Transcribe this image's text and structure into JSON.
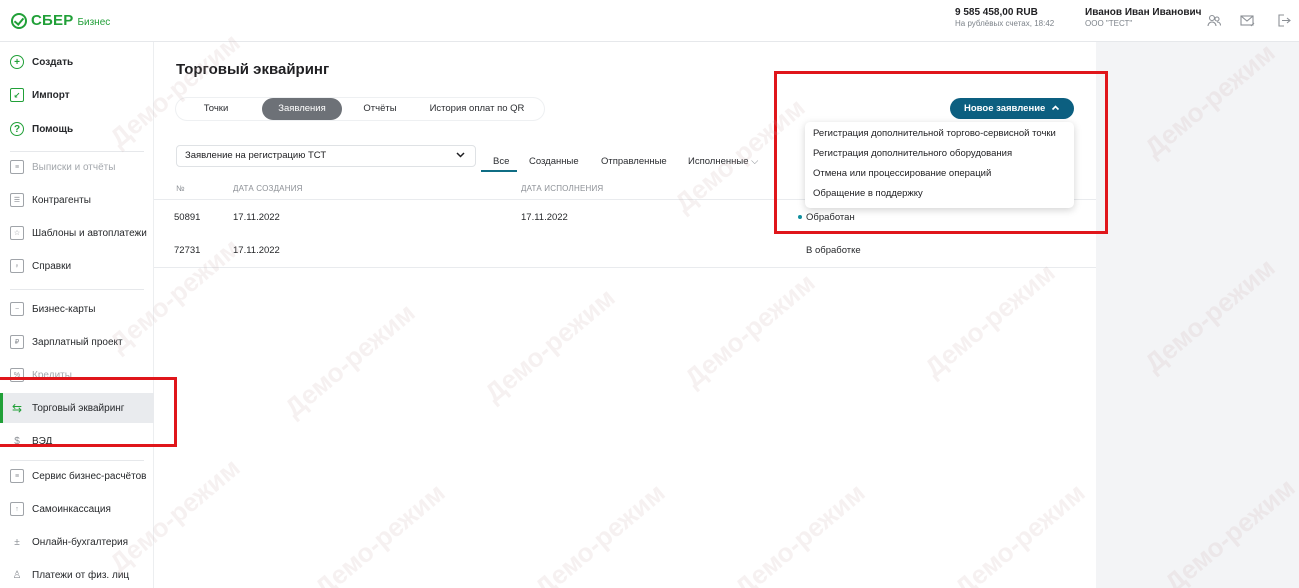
{
  "brand": {
    "name": "СБЕР",
    "suffix": "Бизнес",
    "color": "#21a038"
  },
  "header": {
    "balance": "9 585 458,00 RUB",
    "balance_sub": "На рублёвых счетах, 18:42",
    "user_name": "Иванов Иван Иванович",
    "org": "ООО \"ТЕСТ\"",
    "icons": [
      "profile-icon",
      "mail-icon",
      "logout-icon"
    ]
  },
  "sidebar": {
    "items": [
      {
        "label": "Создать",
        "icon": "plus-circle-icon"
      },
      {
        "label": "Импорт",
        "icon": "import-icon"
      },
      {
        "label": "Помощь",
        "icon": "help-icon"
      },
      {
        "label": "Выписки и отчёты",
        "icon": "statements-icon"
      },
      {
        "label": "Контрагенты",
        "icon": "contractors-icon"
      },
      {
        "label": "Шаблоны и автоплатежи",
        "icon": "templates-icon"
      },
      {
        "label": "Справки",
        "icon": "certificates-icon"
      },
      {
        "label": "Бизнес-карты",
        "icon": "card-icon"
      },
      {
        "label": "Зарплатный проект",
        "icon": "salary-icon"
      },
      {
        "label": "Кредиты",
        "icon": "credit-icon"
      },
      {
        "label": "Торговый эквайринг",
        "icon": "acquiring-icon"
      },
      {
        "label": "ВЭД",
        "icon": "fx-icon"
      },
      {
        "label": "Сервис бизнес-расчётов",
        "icon": "business-settlements-icon"
      },
      {
        "label": "Самоинкассация",
        "icon": "self-collection-icon"
      },
      {
        "label": "Онлайн-бухгалтерия",
        "icon": "accounting-icon"
      },
      {
        "label": "Платежи от физ. лиц",
        "icon": "payments-icon"
      }
    ]
  },
  "main": {
    "title": "Торговый эквайринг",
    "tabs": [
      "Точки",
      "Заявления",
      "Отчёты",
      "История оплат по QR"
    ],
    "active_tab": "Заявления",
    "select_value": "Заявление на регистрацию ТСТ",
    "filters": [
      "Все",
      "Созданные",
      "Отправленные",
      "Исполненные"
    ],
    "active_filter": "Все",
    "table": {
      "headers": [
        "№",
        "ДАТА СОЗДАНИЯ",
        "ДАТА ИСПОЛНЕНИЯ"
      ],
      "rows": [
        {
          "num": "50891",
          "created": "17.11.2022",
          "executed": "17.11.2022",
          "status": "Обработан"
        },
        {
          "num": "72731",
          "created": "17.11.2022",
          "executed": "",
          "status": "В обработке"
        }
      ]
    }
  },
  "new_request": {
    "button_label": "Новое заявление",
    "menu": [
      "Регистрация дополнительной торгово-сервисной точки",
      "Регистрация дополнительного оборудования",
      "Отмена или процессирование операций",
      "Обращение в поддержку"
    ]
  },
  "watermark": "Демо-режим",
  "colors": {
    "accent": "#0c5f80",
    "highlight": "#e0161b",
    "active_tab": "#6d7177"
  }
}
